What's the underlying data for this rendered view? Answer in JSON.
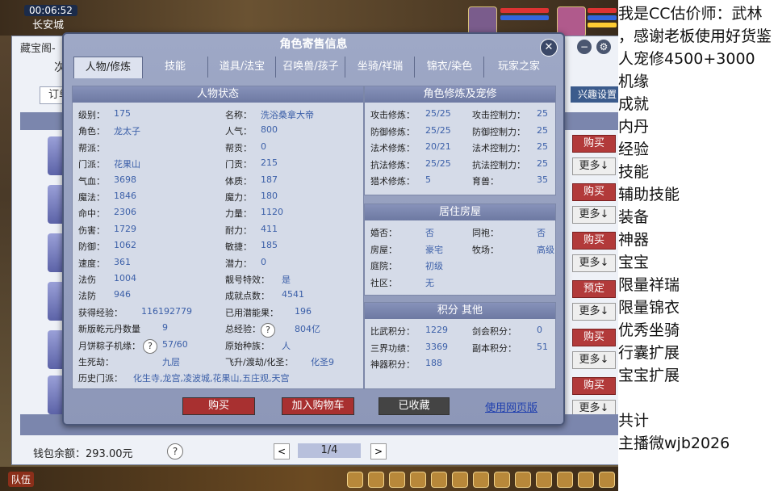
{
  "hud": {
    "clock": "00:06:52",
    "city": "长安城"
  },
  "shop": {
    "title": "藏宝阁-",
    "tab_fragment": "次",
    "select_fragment": "订单",
    "interest_button": "兴趣设置",
    "buy_labels": [
      "购买",
      "购买",
      "购买",
      "预定",
      "购买",
      "购买"
    ],
    "more_label": "更多↓",
    "wallet": "钱包余额：293.00元",
    "help": "?",
    "pager": {
      "prev": "<",
      "text": "1/4",
      "next": ">"
    },
    "ctrl_min": "−",
    "ctrl_settings": "⚙"
  },
  "dialog": {
    "title": "角色寄售信息",
    "close": "✕",
    "tabs": [
      "人物/修炼",
      "技能",
      "道具/法宝",
      "召唤兽/孩子",
      "坐骑/祥瑞",
      "锦衣/染色",
      "玩家之家"
    ],
    "status": {
      "head": "人物状态",
      "left": [
        {
          "k": "级别：",
          "v": "175"
        },
        {
          "k": "角色：",
          "v": "龙太子"
        },
        {
          "k": "帮派：",
          "v": ""
        },
        {
          "k": "门派：",
          "v": "花果山"
        },
        {
          "k": "气血：",
          "v": "3698"
        },
        {
          "k": "魔法：",
          "v": "1846"
        },
        {
          "k": "命中：",
          "v": "2306"
        },
        {
          "k": "伤害：",
          "v": "1729"
        },
        {
          "k": "防御：",
          "v": "1062"
        },
        {
          "k": "速度：",
          "v": "361"
        },
        {
          "k": "法伤",
          "v": "1004"
        },
        {
          "k": "法防",
          "v": "946"
        },
        {
          "k": "获得经验：",
          "v": "116192779"
        },
        {
          "k": "新版乾元丹数量",
          "v": "9"
        },
        {
          "k": "月饼粽子机缘：",
          "v": "57/60"
        },
        {
          "k": "生死劫：",
          "v": "九层"
        },
        {
          "k": "历史门派：",
          "v": "化生寺,龙宫,凌波城,花果山,五庄观,天宫"
        }
      ],
      "right": [
        {
          "k": "名称：",
          "v": "洗浴桑拿大帝"
        },
        {
          "k": "人气：",
          "v": "800"
        },
        {
          "k": "帮贡：",
          "v": "0"
        },
        {
          "k": "门贡：",
          "v": "215"
        },
        {
          "k": "体质：",
          "v": "187"
        },
        {
          "k": "魔力：",
          "v": "180"
        },
        {
          "k": "力量：",
          "v": "1120"
        },
        {
          "k": "耐力：",
          "v": "411"
        },
        {
          "k": "敏捷：",
          "v": "185"
        },
        {
          "k": "潜力：",
          "v": "0"
        },
        {
          "k": "靓号特效：",
          "v": "是"
        },
        {
          "k": "成就点数：",
          "v": "4541"
        },
        {
          "k": "已用潜能果：",
          "v": "196"
        },
        {
          "k": "总经验：",
          "v": "804亿"
        },
        {
          "k": "原始种族：",
          "v": "人"
        },
        {
          "k": "飞升/渡劫/化圣：",
          "v": "化圣9"
        }
      ]
    },
    "cultivation": {
      "head": "角色修炼及宠修",
      "rows": [
        {
          "a": "攻击修炼：",
          "av": "25/25",
          "b": "攻击控制力：",
          "bv": "25"
        },
        {
          "a": "防御修炼：",
          "av": "25/25",
          "b": "防御控制力：",
          "bv": "25"
        },
        {
          "a": "法术修炼：",
          "av": "20/21",
          "b": "法术控制力：",
          "bv": "25"
        },
        {
          "a": "抗法修炼：",
          "av": "25/25",
          "b": "抗法控制力：",
          "bv": "25"
        },
        {
          "a": "猎术修炼：",
          "av": "5",
          "b": "育兽：",
          "bv": "35"
        }
      ]
    },
    "house": {
      "head": "居住房屋",
      "rows": [
        {
          "a": "婚否：",
          "av": "否",
          "b": "同袍：",
          "bv": "否"
        },
        {
          "a": "房屋：",
          "av": "豪宅",
          "b": "牧场：",
          "bv": "高级"
        },
        {
          "a": "庭院：",
          "av": "初级",
          "b": "",
          "bv": ""
        },
        {
          "a": "社区：",
          "av": "无",
          "b": "",
          "bv": ""
        }
      ]
    },
    "points": {
      "head": "积分 其他",
      "rows": [
        {
          "a": "比武积分：",
          "av": "1229",
          "b": "剑会积分：",
          "bv": "0"
        },
        {
          "a": "三界功绩：",
          "av": "3369",
          "b": "副本积分：",
          "bv": "51"
        },
        {
          "a": "神器积分：",
          "av": "188",
          "b": "",
          "bv": ""
        }
      ]
    },
    "buttons": {
      "buy": "购买",
      "cart": "加入购物车",
      "collected": "已收藏",
      "web": "使用网页版"
    }
  },
  "bottom": {
    "team": "队伍"
  },
  "side_text": [
    "我是CC估价师：武林",
    "，感谢老板使用好货鉴",
    "人宠修4500+3000",
    "机缘",
    "成就",
    "内丹",
    "经验",
    "技能",
    "辅助技能",
    "装备",
    "神器",
    "宝宝",
    "限量祥瑞",
    "限量锦衣",
    "优秀坐骑",
    "行囊扩展",
    "宝宝扩展",
    "",
    "共计",
    "主播微wjb2026"
  ]
}
